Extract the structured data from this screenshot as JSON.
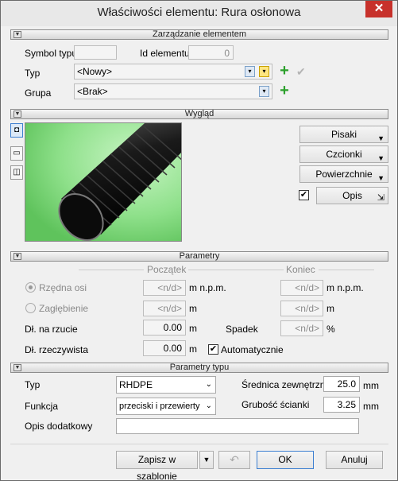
{
  "window": {
    "title": "Właściwości elementu: Rura osłonowa",
    "close": "✕"
  },
  "sections": {
    "management": "Zarządzanie elementem",
    "appearance": "Wygląd",
    "parameters": "Parametry",
    "type_parameters": "Parametry typu"
  },
  "management": {
    "symbol_label": "Symbol typu",
    "symbol_value": "",
    "id_label": "Id elementu",
    "id_value": "0",
    "type_label": "Typ",
    "type_value": "<Nowy>",
    "group_label": "Grupa",
    "group_value": "<Brak>"
  },
  "appearance": {
    "pens": "Pisaki",
    "fonts": "Czcionki",
    "surfaces": "Powierzchnie",
    "description": "Opis",
    "description_checked": true
  },
  "parameters": {
    "start_header": "Początek",
    "end_header": "Koniec",
    "axis_ordinate": "Rzędna osi",
    "axis_start": "<n/d>",
    "axis_start_unit": "m n.p.m.",
    "axis_end": "<n/d>",
    "axis_end_unit": "m n.p.m.",
    "depth": "Zagłębienie",
    "depth_start": "<n/d>",
    "depth_start_unit": "m",
    "depth_end": "<n/d>",
    "depth_end_unit": "m",
    "plan_length": "Dł. na rzucie",
    "plan_length_value": "0.00",
    "plan_length_unit": "m",
    "slope": "Spadek",
    "slope_value": "<n/d>",
    "slope_unit": "%",
    "real_length": "Dł. rzeczywista",
    "real_length_value": "0.00",
    "real_length_unit": "m",
    "automatic": "Automatycznie",
    "automatic_checked": true
  },
  "type_params": {
    "type_label": "Typ",
    "type_value": "RHDPE",
    "function_label": "Funkcja",
    "function_value": "przeciski i przewierty",
    "ext_diameter_label": "Średnica zewnętrzna",
    "ext_diameter_value": "25.0",
    "ext_diameter_unit": "mm",
    "wall_label": "Grubość ścianki",
    "wall_value": "3.25",
    "wall_unit": "mm",
    "extra_desc_label": "Opis dodatkowy",
    "extra_desc_value": ""
  },
  "footer": {
    "save_template": "Zapisz w szablonie",
    "ok": "OK",
    "cancel": "Anuluj"
  }
}
